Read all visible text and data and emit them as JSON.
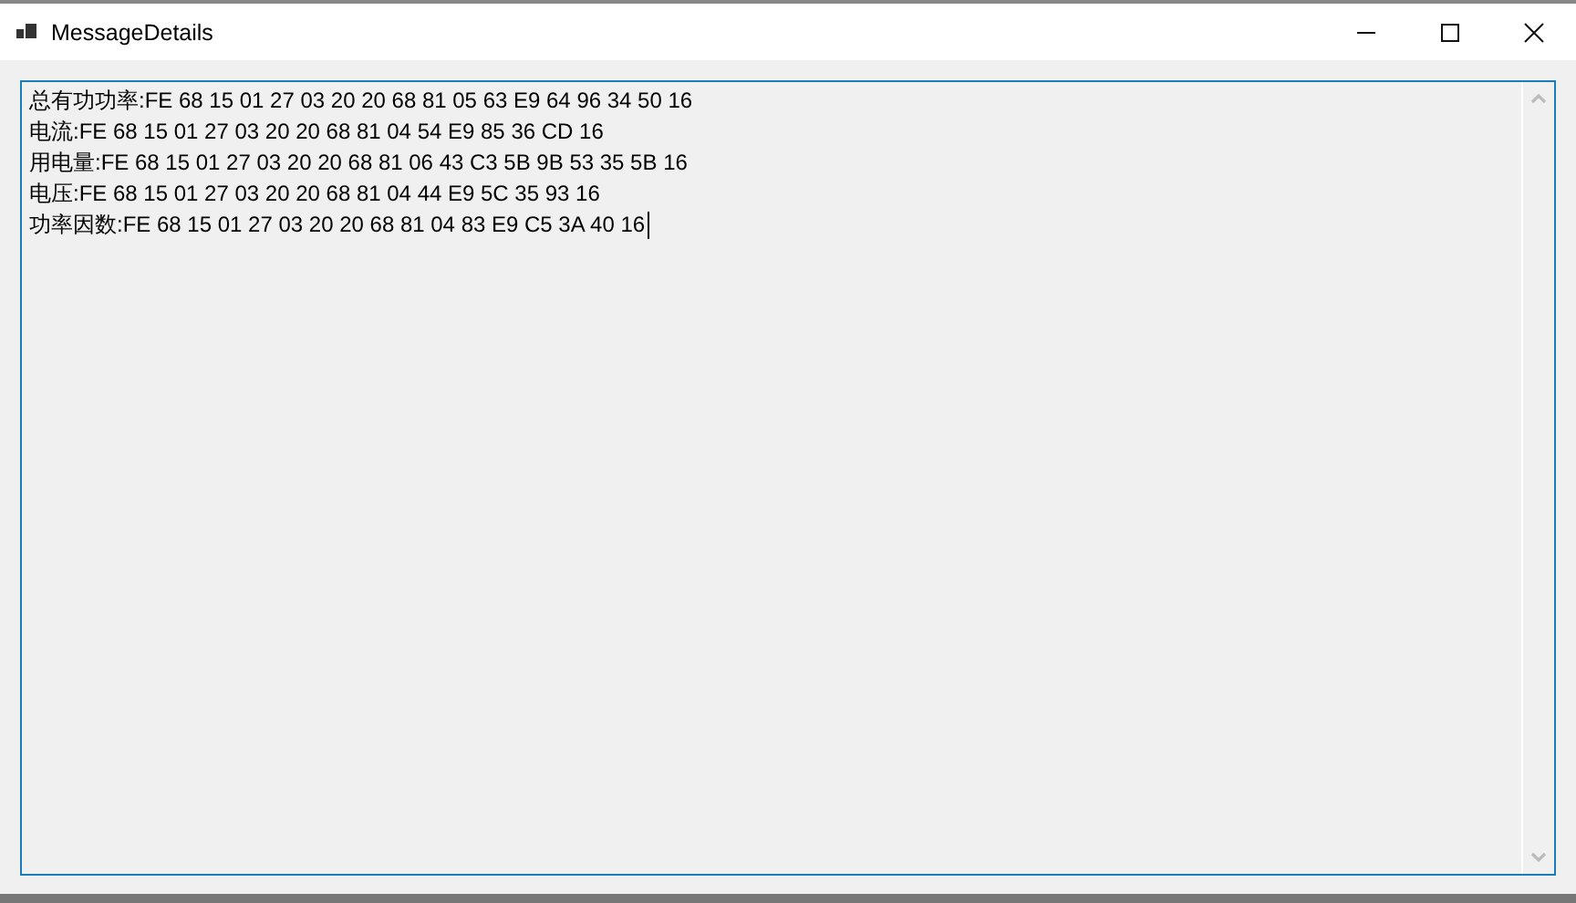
{
  "window": {
    "title": "MessageDetails"
  },
  "text_box": {
    "focused": true,
    "lines": [
      "总有功功率:FE 68 15 01 27 03 20 20 68 81 05 63 E9 64 96 34 50 16",
      "电流:FE 68 15 01 27 03 20 20 68 81 04 54 E9 85 36 CD 16",
      "用电量:FE 68 15 01 27 03 20 20 68 81 06 43 C3 5B 9B 53 35 5B 16",
      "电压:FE 68 15 01 27 03 20 20 68 81 04 44 E9 5C 35 93 16",
      "功率因数:FE 68 15 01 27 03 20 20 68 81 04 83 E9 C5 3A 40 16"
    ]
  }
}
